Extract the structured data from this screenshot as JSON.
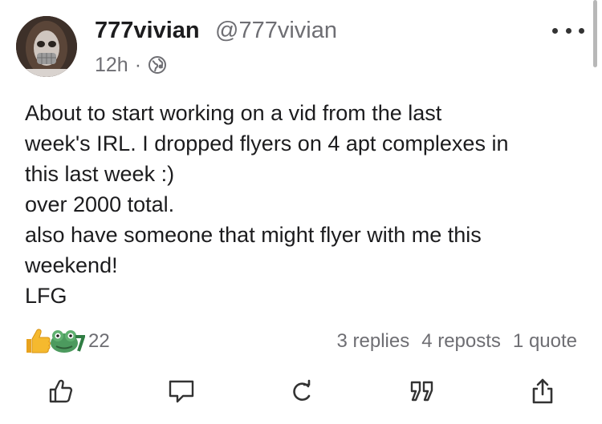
{
  "author": {
    "display_name": "777vivian",
    "handle": "@777vivian"
  },
  "meta": {
    "time": "12h",
    "separator": "·",
    "visibility_icon": "globe-icon"
  },
  "post": {
    "lines": [
      "About to start working on a vid from the last",
      "week's IRL. I dropped flyers on 4 apt complexes in",
      "this last week :)",
      "over 2000 total.",
      "also have someone that might flyer with me this",
      "weekend!",
      "LFG"
    ]
  },
  "reactions": {
    "icons": [
      "thumbs-up-emoji",
      "frog-emoji"
    ],
    "count": "22"
  },
  "stats": {
    "replies": "3 replies",
    "reposts": "4 reposts",
    "quotes": "1 quote"
  },
  "actions": [
    "like",
    "reply",
    "repost",
    "quote",
    "share"
  ],
  "colors": {
    "text": "#1c1c1e",
    "secondary": "#6e6e73",
    "icon": "#333333",
    "thumbs": "#f5b92e"
  }
}
